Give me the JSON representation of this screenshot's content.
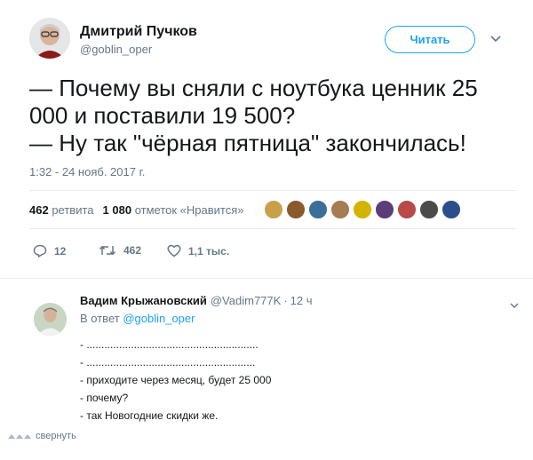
{
  "tweet": {
    "author_name": "Дмитрий Пучков",
    "author_handle": "@goblin_oper",
    "follow_label": "Читать",
    "text_lines": [
      "— Почему вы сняли с ноутбука ценник 25",
      "000 и поставили 19 500?",
      "— Ну так \"чёрная пятница\" закончилась!"
    ],
    "timestamp": "1:32 - 24 нояб. 2017 г.",
    "retweets_count": "462",
    "retweets_label": "ретвита",
    "likes_count": "1 080",
    "likes_label": "отметок «Нравится»",
    "liker_colors": [
      "#c9a04a",
      "#8a5a2b",
      "#3a6f9a",
      "#a67c52",
      "#d4b200",
      "#5b3d7a",
      "#b84a4a",
      "#4a4a4a",
      "#2b4f8a"
    ],
    "actions": {
      "reply_count": "12",
      "retweet_count": "462",
      "like_count": "1,1 тыс."
    }
  },
  "reply": {
    "author_name": "Вадим Крыжановский",
    "author_handle": "@Vadim777K",
    "dot": "·",
    "time": "12 ч",
    "in_reply_prefix": "В ответ",
    "in_reply_to": "@goblin_oper",
    "text_lines": [
      "- ..........................................................",
      " - .........................................................",
      "- приходите через месяц, будет 25 000",
      "- почему?",
      "- так Новогодние скидки же."
    ]
  },
  "collapse_label": "свернуть",
  "colors": {
    "accent": "#1da1f2",
    "muted": "#657786",
    "text": "#14171a",
    "divider": "#e6ecf0"
  }
}
